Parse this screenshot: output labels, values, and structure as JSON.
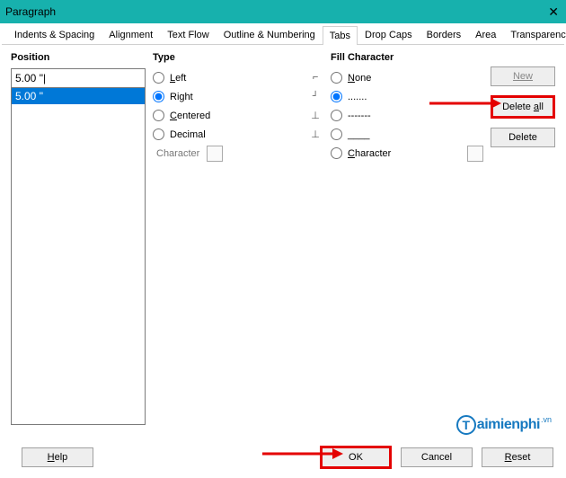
{
  "window": {
    "title": "Paragraph"
  },
  "tabs": {
    "items": [
      "Indents & Spacing",
      "Alignment",
      "Text Flow",
      "Outline & Numbering",
      "Tabs",
      "Drop Caps",
      "Borders",
      "Area",
      "Transparency"
    ],
    "active": 4
  },
  "position": {
    "label": "Position",
    "input_value": "5.00 \"|",
    "list": [
      "5.00 \""
    ]
  },
  "type": {
    "label": "Type",
    "options": [
      {
        "text": "Left",
        "accel": "L",
        "glyph": "⌐"
      },
      {
        "text": "Right",
        "accel": "",
        "glyph": "┘"
      },
      {
        "text": "Centered",
        "accel": "C",
        "glyph": "⊥"
      },
      {
        "text": "Decimal",
        "accel": "",
        "glyph": "⊥"
      }
    ],
    "selected": 1,
    "char_label": "Character"
  },
  "fill": {
    "label": "Fill Character",
    "options": [
      {
        "text": "None",
        "accel": "N"
      },
      {
        "text": ".......",
        "accel": ""
      },
      {
        "text": "-------",
        "accel": ""
      },
      {
        "text": "____",
        "accel": ""
      },
      {
        "text": "Character",
        "accel": "C"
      }
    ],
    "selected": 1
  },
  "buttons": {
    "new": "New",
    "delete_all": "Delete all",
    "delete": "Delete"
  },
  "footer": {
    "help": "Help",
    "ok": "OK",
    "cancel": "Cancel",
    "reset": "Reset"
  },
  "watermark": {
    "text": "aimienphi",
    "suffix": ".vn"
  }
}
